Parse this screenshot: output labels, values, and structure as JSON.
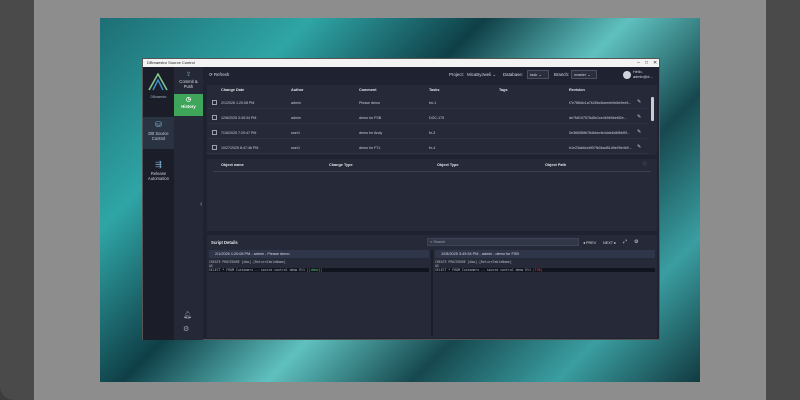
{
  "window": {
    "title": "DBmaestro Source Control"
  },
  "nav": {
    "logo_text": "DBmaestro",
    "items": [
      {
        "label": "DB Source Control",
        "icon": "database-branch-icon"
      },
      {
        "label": "Release Automation",
        "icon": "release-flow-icon"
      }
    ],
    "sub_items": [
      {
        "label": "Commit & Push",
        "icon": "commit-icon"
      },
      {
        "label": "History",
        "icon": "history-icon"
      }
    ]
  },
  "toolbar": {
    "refresh_label": "Refresh",
    "project_label": "Project:",
    "project_value": "MicaByJweli",
    "database_label": "Database:",
    "database_value": "task",
    "branch_label": "Branch:",
    "branch_value": "master",
    "user_greeting": "Hello,",
    "user_email": "admin@dbmaestro.com"
  },
  "history": {
    "columns": [
      "Change Date",
      "Author",
      "Comment",
      "Tasks",
      "Tags",
      "Revision"
    ],
    "rows": [
      {
        "date": "2/1/2026 1:20:08 PM",
        "author": "admin",
        "comment": "Please demo",
        "tasks": "tm-1",
        "tags": "",
        "revision": "f7e7f8b6c1a7b28bc6ceeeb9e8e9ee5..."
      },
      {
        "date": "12/8/2025 3:49:34 PM",
        "author": "admin",
        "comment": "demo for FSB",
        "tasks": "DOC-175",
        "tags": "",
        "revision": "de7fdf197576d5e1ce4b9b9be6f2e..."
      },
      {
        "date": "7/16/2025 7:29:47 PM",
        "author": "user1",
        "comment": "demo for Andy",
        "tasks": "fn-3",
        "tags": "",
        "revision": "0e3665f6fb784bbecfe4dde6d6f6bf9f..."
      },
      {
        "date": "10/27/2025 8:47:46 PM",
        "author": "user1",
        "comment": "demo for FTL",
        "tasks": "fn-4",
        "tags": "",
        "revision": "b1e23ab6ce6f07fb0bad51d9e09e4b9..."
      }
    ]
  },
  "objects": {
    "columns": [
      "Object name",
      "Change Type",
      "Object Type",
      "Object Path"
    ]
  },
  "script": {
    "title": "Script Details",
    "search_placeholder": "Search",
    "prev_label": "PREV",
    "next_label": "NEXT",
    "left": {
      "header": "2/1/2026 1:20:08 PM - admin - Please demo",
      "lines": [
        "CREATE PROCEDURE [dbo].[ReturnTableName]",
        "AS",
        "SELECT * FROM Customers -- source control demo Et1 [[demo]]"
      ],
      "highlight": "[[demo]]"
    },
    "right": {
      "header": "12/8/2025 3:49:34 PM - admin - demo for FSB",
      "lines": [
        "CREATE PROCEDURE [dbo].[ReturnTableName]",
        "AS",
        "SELECT * FROM Customers -- source control demo Et1 [FSB]"
      ],
      "highlight": "[FSB]"
    }
  }
}
